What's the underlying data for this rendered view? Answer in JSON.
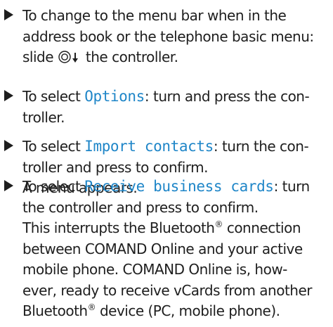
{
  "colors": {
    "menu_text": "#1f86c8",
    "body_text": "#1e1e1e",
    "bullet": "#1e1e1e"
  },
  "icons": {
    "step_bullet": "right-triangle-bullet",
    "controller": "controller-slide-down-icon"
  },
  "steps": [
    {
      "line1": "To change to the menu bar when in the",
      "line2": "address book or the telephone basic menu:",
      "line3_pre": "slide",
      "line3_post": "the controller."
    },
    {
      "pre": "To select",
      "menu": "Options",
      "post": ": turn and press the con-",
      "line2": "troller."
    },
    {
      "pre": "To select",
      "menu": "Import contacts",
      "post": ": turn the con-",
      "line2": "troller and press to confirm.",
      "line3": "A menu appears."
    },
    {
      "pre": "To select",
      "menu": "Receive business cards",
      "post": ": turn",
      "line2": "the controller and press to confirm.",
      "line3_pre": "This interrupts the Bluetooth",
      "line3_reg": "®",
      "line3_post": " connection",
      "line4": "between COMAND Online and your active",
      "line5": "mobile phone. COMAND Online is, how-",
      "line6": "ever, ready to receive vCards from another",
      "line7_pre": "Bluetooth",
      "line7_reg": "®",
      "line7_post": " device (PC, mobile phone)."
    }
  ]
}
